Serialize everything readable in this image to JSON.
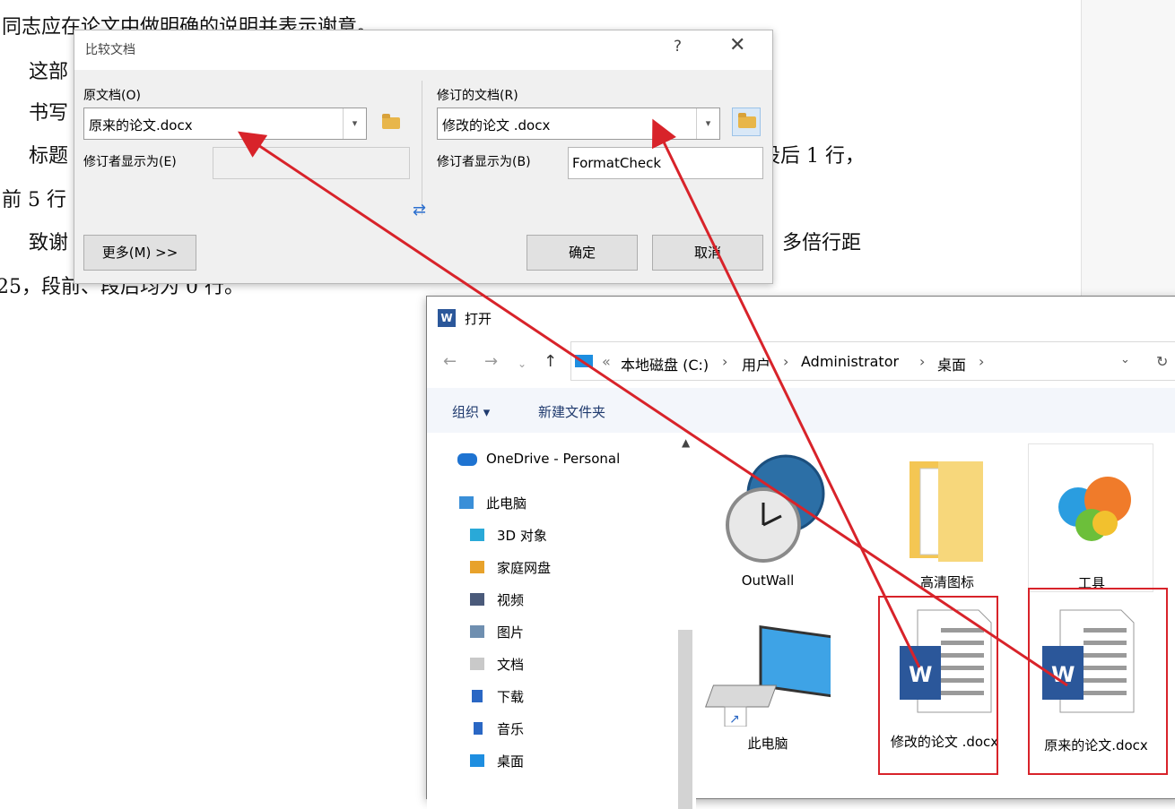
{
  "document": {
    "lines": [
      "同志应在论文中做明确的说明并表示谢意。",
      "这部",
      "书写",
      "标题",
      "前 5 行",
      "致谢",
      "25，段前、段后均为 0 行。"
    ],
    "right_fragments": [
      "设后 1 行，",
      "多倍行距"
    ]
  },
  "compare_dialog": {
    "title": "比较文档",
    "help": "?",
    "close": "✕",
    "original_label": "原文档(O)",
    "original_value": "原来的论文.docx",
    "original_author_label": "修订者显示为(E)",
    "original_author_value": "",
    "revised_label": "修订的文档(R)",
    "revised_value": "修改的论文 .docx",
    "revised_author_label": "修订者显示为(B)",
    "revised_author_value": "FormatCheck",
    "swap_icon": "⇄",
    "more_button": "更多(M) >>",
    "ok_button": "确定",
    "cancel_button": "取消"
  },
  "open_dialog": {
    "title": "打开",
    "app_badge": "W",
    "address": [
      "«",
      "本地磁盘 (C:)",
      "›",
      "用户",
      "›",
      "Administrator",
      "›",
      "桌面",
      "›"
    ],
    "toolbar": {
      "organize": "组织 ▾",
      "new_folder": "新建文件夹"
    },
    "nav_items": [
      "OneDrive - Personal",
      "此电脑",
      "3D 对象",
      "家庭网盘",
      "视频",
      "图片",
      "文档",
      "下载",
      "音乐",
      "桌面"
    ],
    "files": [
      "OutWall",
      "高清图标",
      "工具",
      "此电脑",
      "修改的论文 .docx",
      "原来的论文.docx"
    ]
  },
  "colors": {
    "annotation": "#d8232a",
    "accent": "#2b579a"
  }
}
